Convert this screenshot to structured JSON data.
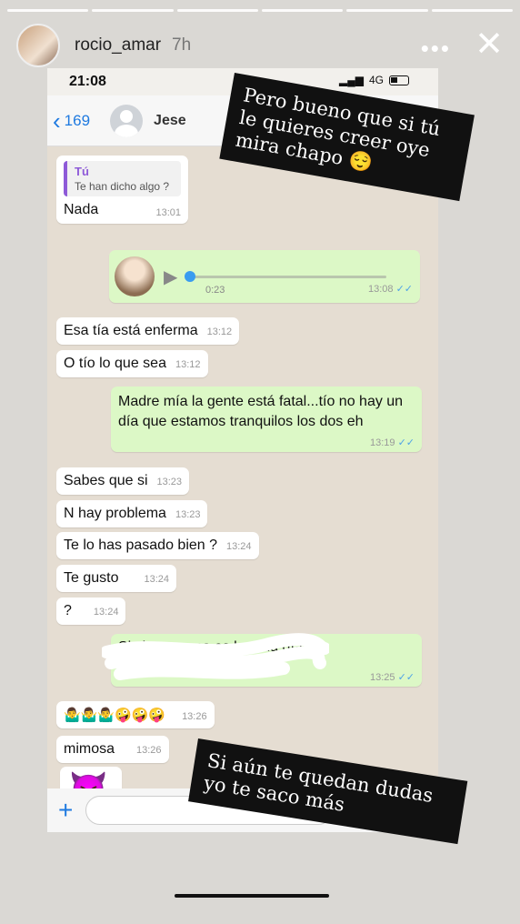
{
  "story": {
    "username": "rocio_amar",
    "time_ago": "7h",
    "more_label": "•••",
    "close_label": "✕",
    "progress_segments": 6
  },
  "phone": {
    "clock": "21:08",
    "network": "4G"
  },
  "chat_header": {
    "back_count": "169",
    "contact_name": "Jese"
  },
  "messages": [
    {
      "id": "m1",
      "dir": "in",
      "quote_author": "Tú",
      "quote_text": "Te han dicho algo ?",
      "text": "Nada",
      "time": "13:01"
    },
    {
      "id": "m2",
      "dir": "out",
      "type": "audio",
      "duration": "0:23",
      "time": "13:08"
    },
    {
      "id": "m3",
      "dir": "in",
      "text": "Esa tía está enferma",
      "time": "13:12"
    },
    {
      "id": "m4",
      "dir": "in",
      "text": "O tío lo que sea",
      "time": "13:12"
    },
    {
      "id": "m5",
      "dir": "out",
      "text": "Madre mía la gente está fatal...tío no hay un día que estamos tranquilos los dos eh",
      "time": "13:19"
    },
    {
      "id": "m6",
      "dir": "in",
      "text": "Sabes que si",
      "time": "13:23"
    },
    {
      "id": "m7",
      "dir": "in",
      "text": "N hay problema",
      "time": "13:23"
    },
    {
      "id": "m8",
      "dir": "in",
      "text": "Te lo has pasado bien ?",
      "time": "13:24"
    },
    {
      "id": "m9",
      "dir": "in",
      "text": "Te gusto",
      "time": "13:24"
    },
    {
      "id": "m10",
      "dir": "in",
      "text": "?",
      "time": "13:24"
    },
    {
      "id": "m11",
      "dir": "out",
      "text": "Si claro... y no es hu                  ada día",
      "time": "13:25"
    },
    {
      "id": "m12",
      "dir": "in",
      "text": "🤷‍♂️🤷‍♂️🤷‍♂️🤪🤪🤪",
      "time": "13:26"
    },
    {
      "id": "m13",
      "dir": "in",
      "text": "mimosa",
      "time": "13:26"
    },
    {
      "id": "m14",
      "dir": "in",
      "text": "😈",
      "time": ""
    }
  ],
  "stickers": [
    {
      "id": "top",
      "text": "Pero bueno que si tú le quieres creer oye mira chapo 😌"
    },
    {
      "id": "bottom",
      "text": "Si aún te quedan dudas yo te saco más"
    }
  ]
}
